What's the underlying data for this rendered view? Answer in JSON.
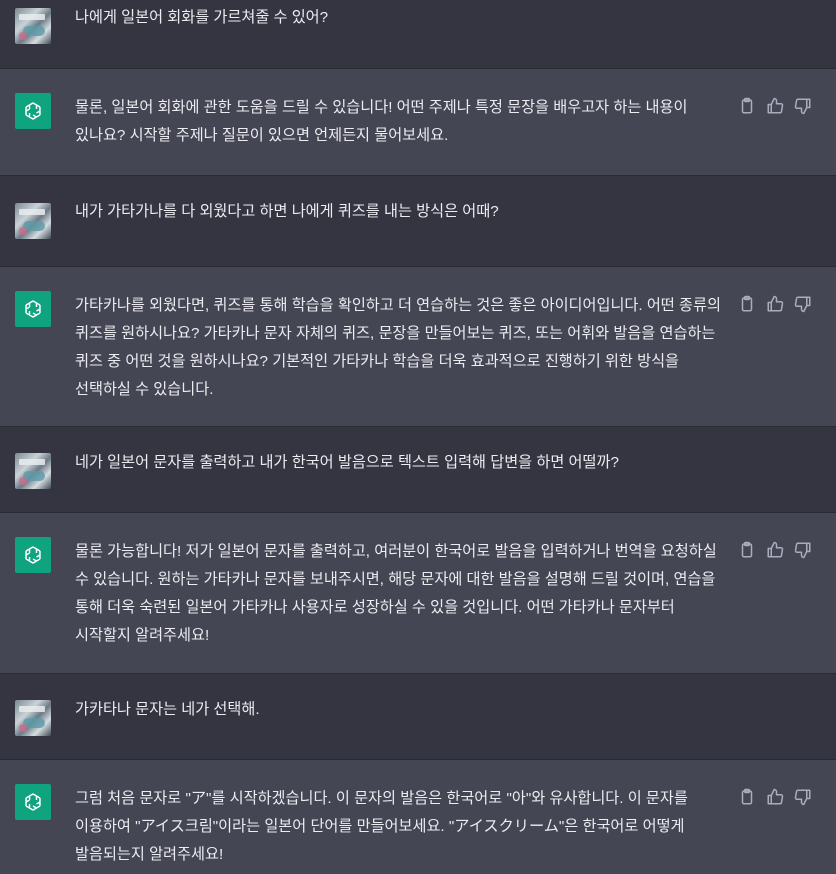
{
  "conversation": [
    {
      "role": "user",
      "text": "나에게 일본어 회화를 가르쳐줄 수 있어?"
    },
    {
      "role": "assistant",
      "text": "물론, 일본어 회화에 관한 도움을 드릴 수 있습니다! 어떤 주제나 특정 문장을 배우고자 하는 내용이 있나요? 시작할 주제나 질문이 있으면 언제든지 물어보세요."
    },
    {
      "role": "user",
      "text": "내가 가타가나를 다 외웠다고 하면 나에게 퀴즈를 내는 방식은 어때?"
    },
    {
      "role": "assistant",
      "text": "가타카나를 외웠다면, 퀴즈를 통해 학습을 확인하고 더 연습하는 것은 좋은 아이디어입니다. 어떤 종류의 퀴즈를 원하시나요? 가타카나 문자 자체의 퀴즈, 문장을 만들어보는 퀴즈, 또는 어휘와 발음을 연습하는 퀴즈 중 어떤 것을 원하시나요? 기본적인 가타카나 학습을 더욱 효과적으로 진행하기 위한 방식을 선택하실 수 있습니다."
    },
    {
      "role": "user",
      "text": "네가 일본어 문자를 출력하고 내가 한국어 발음으로 텍스트 입력해 답변을 하면 어떨까?"
    },
    {
      "role": "assistant",
      "text": "물론 가능합니다! 저가 일본어 문자를 출력하고, 여러분이 한국어로 발음을 입력하거나 번역을 요청하실 수 있습니다. 원하는 가타카나 문자를 보내주시면, 해당 문자에 대한 발음을 설명해 드릴 것이며, 연습을 통해 더욱 숙련된 일본어 가타카나 사용자로 성장하실 수 있을 것입니다. 어떤 가타카나 문자부터 시작할지 알려주세요!"
    },
    {
      "role": "user",
      "text": "가카타나 문자는 네가 선택해."
    },
    {
      "role": "assistant",
      "text": "그럼 처음 문자로 \"ア\"를 시작하겠습니다. 이 문자의 발음은 한국어로 \"아\"와 유사합니다. 이 문자를 이용하여 \"アイス크림\"이라는 일본어 단어를 만들어보세요. \"アイスクリーム\"은 한국어로 어떻게 발음되는지 알려주세요!"
    }
  ],
  "icons": {
    "copy": "clipboard-icon",
    "like": "thumbs-up-icon",
    "dislike": "thumbs-down-icon",
    "assistant_avatar": "openai-logo-icon"
  },
  "colors": {
    "user_bg": "#343541",
    "assistant_bg": "#444654",
    "assistant_avatar_bg": "#10a37f",
    "text": "#ececf1",
    "icon": "#acacbe"
  }
}
